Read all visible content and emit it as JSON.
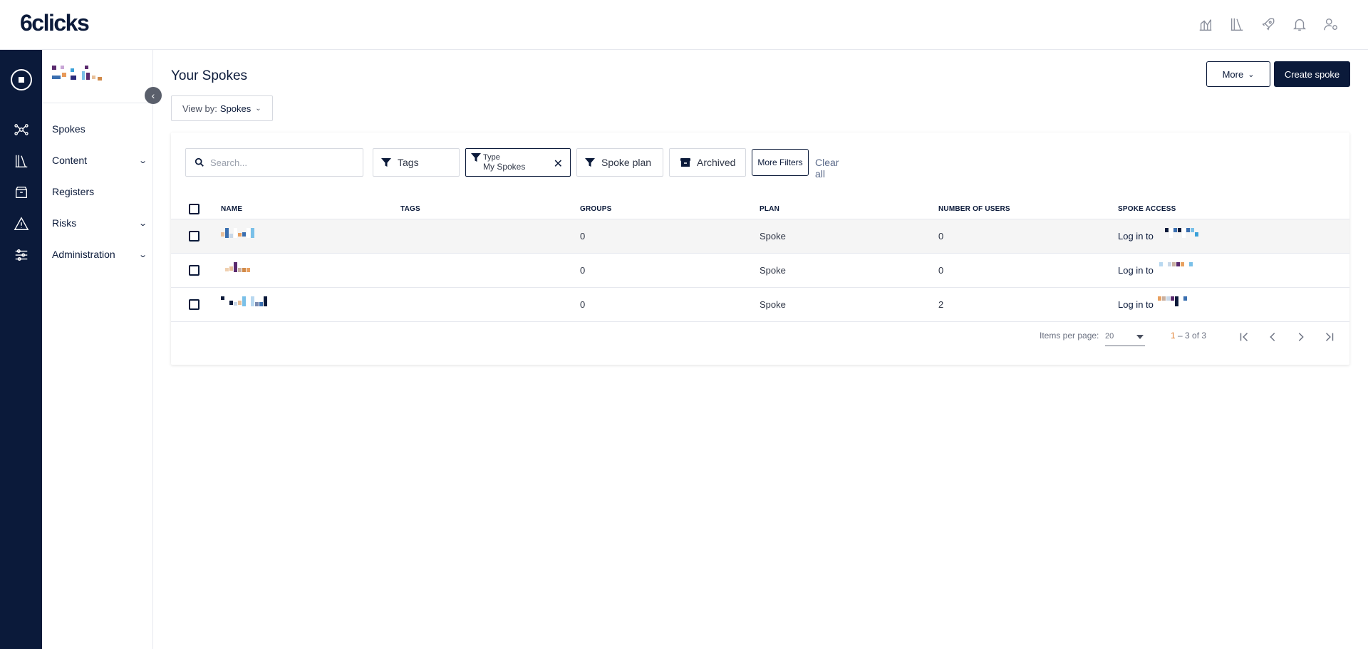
{
  "app": {
    "logo_text": "6clicks"
  },
  "topbar": {
    "icons": [
      "analytics-icon",
      "library-icon",
      "rocket-icon",
      "bell-icon",
      "user-settings-icon"
    ]
  },
  "rail": {
    "icons": [
      "org-icon",
      "hub-network-icon",
      "content-library-icon",
      "registers-box-icon",
      "risk-warning-icon",
      "administration-sliders-icon"
    ]
  },
  "sidenav": {
    "items": [
      {
        "label": "Spokes",
        "has_chevron": false
      },
      {
        "label": "Content",
        "has_chevron": true
      },
      {
        "label": "Registers",
        "has_chevron": false
      },
      {
        "label": "Risks",
        "has_chevron": true
      },
      {
        "label": "Administration",
        "has_chevron": true
      }
    ]
  },
  "page": {
    "title": "Your Spokes",
    "view_by_label": "View by:",
    "view_by_value": "Spokes",
    "more_label": "More",
    "create_label": "Create spoke"
  },
  "filters": {
    "search_placeholder": "Search...",
    "tags_label": "Tags",
    "type_label": "Type",
    "type_value": "My Spokes",
    "spoke_plan_label": "Spoke plan",
    "archived_label": "Archived",
    "more_filters_label": "More Filters",
    "clear_all_label": "Clear all"
  },
  "table": {
    "columns": [
      "NAME",
      "TAGS",
      "GROUPS",
      "PLAN",
      "NUMBER OF USERS",
      "SPOKE ACCESS"
    ],
    "rows": [
      {
        "name": "",
        "tags": "",
        "groups": "0",
        "plan": "Spoke",
        "users": "0",
        "access": "Log in to"
      },
      {
        "name": "",
        "tags": "",
        "groups": "0",
        "plan": "Spoke",
        "users": "0",
        "access": "Log in to"
      },
      {
        "name": "",
        "tags": "",
        "groups": "0",
        "plan": "Spoke",
        "users": "2",
        "access": "Log in to"
      }
    ]
  },
  "pagination": {
    "items_per_page_label": "Items per page:",
    "items_per_page_value": "20",
    "range_start": "1",
    "range_rest": " – 3 of 3"
  },
  "colors": {
    "navy": "#0b1a3a",
    "accent_orange": "#e07b2a",
    "rail_bg": "#0b1a3a"
  }
}
